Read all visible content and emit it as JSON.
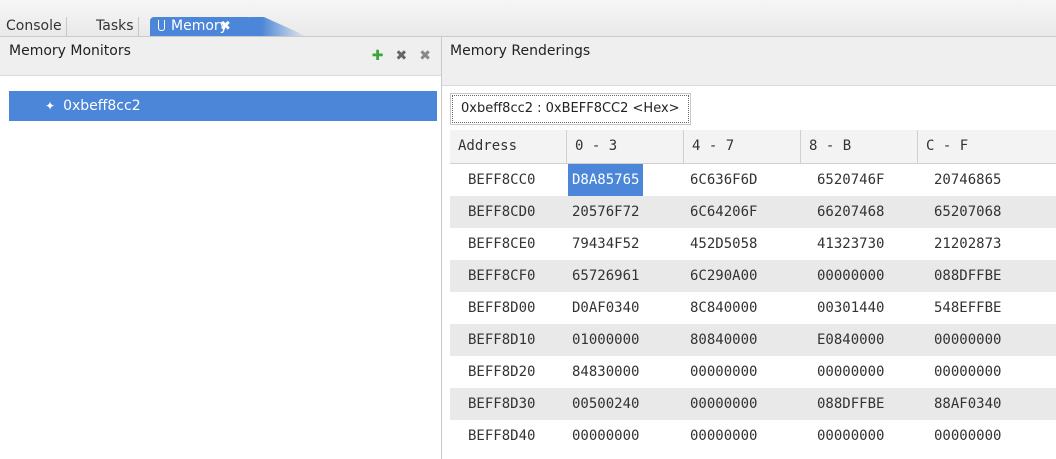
{
  "tabs": [
    {
      "label": "Console"
    },
    {
      "label": "Tasks"
    },
    {
      "label": "Memory",
      "icon": "memory-icon",
      "close_glyph": "✖"
    }
  ],
  "left": {
    "title": "Memory Monitors",
    "toolbar": [
      {
        "icon": "add-monitor-icon",
        "glyph": "✚"
      },
      {
        "icon": "remove-monitor-icon",
        "glyph": "✖"
      },
      {
        "icon": "remove-all-icon",
        "glyph": "✖"
      }
    ],
    "tree": [
      {
        "label": "0xbeff8cc2",
        "bullet": "✦"
      }
    ]
  },
  "right": {
    "title": "Memory Renderings",
    "rendering_tab": "0xbeff8cc2 : 0xBEFF8CC2 <Hex>"
  },
  "table": {
    "headers": [
      "Address",
      "0 - 3",
      "4 - 7",
      "8 - B",
      "C - F"
    ],
    "rows": [
      {
        "addr": "BEFF8CC0",
        "cells": [
          "D8A85765",
          "6C636F6D",
          "6520746F",
          "20746865"
        ]
      },
      {
        "addr": "BEFF8CD0",
        "cells": [
          "20576F72",
          "6C64206F",
          "66207468",
          "65207068"
        ]
      },
      {
        "addr": "BEFF8CE0",
        "cells": [
          "79434F52",
          "452D5058",
          "41323730",
          "21202873"
        ]
      },
      {
        "addr": "BEFF8CF0",
        "cells": [
          "65726961",
          "6C290A00",
          "00000000",
          "088DFFBE"
        ]
      },
      {
        "addr": "BEFF8D00",
        "cells": [
          "D0AF0340",
          "8C840000",
          "00301440",
          "548EFFBE"
        ]
      },
      {
        "addr": "BEFF8D10",
        "cells": [
          "01000000",
          "80840000",
          "E0840000",
          "00000000"
        ]
      },
      {
        "addr": "BEFF8D20",
        "cells": [
          "84830000",
          "00000000",
          "00000000",
          "00000000"
        ]
      },
      {
        "addr": "BEFF8D30",
        "cells": [
          "00500240",
          "00000000",
          "088DFFBE",
          "88AF0340"
        ]
      },
      {
        "addr": "BEFF8D40",
        "cells": [
          "00000000",
          "00000000",
          "00000000",
          "00000000"
        ]
      }
    ],
    "selected_cell": "D8A85765"
  },
  "colors": {
    "accent": "#4b86d8",
    "alt_row": "#e9e9e9"
  }
}
